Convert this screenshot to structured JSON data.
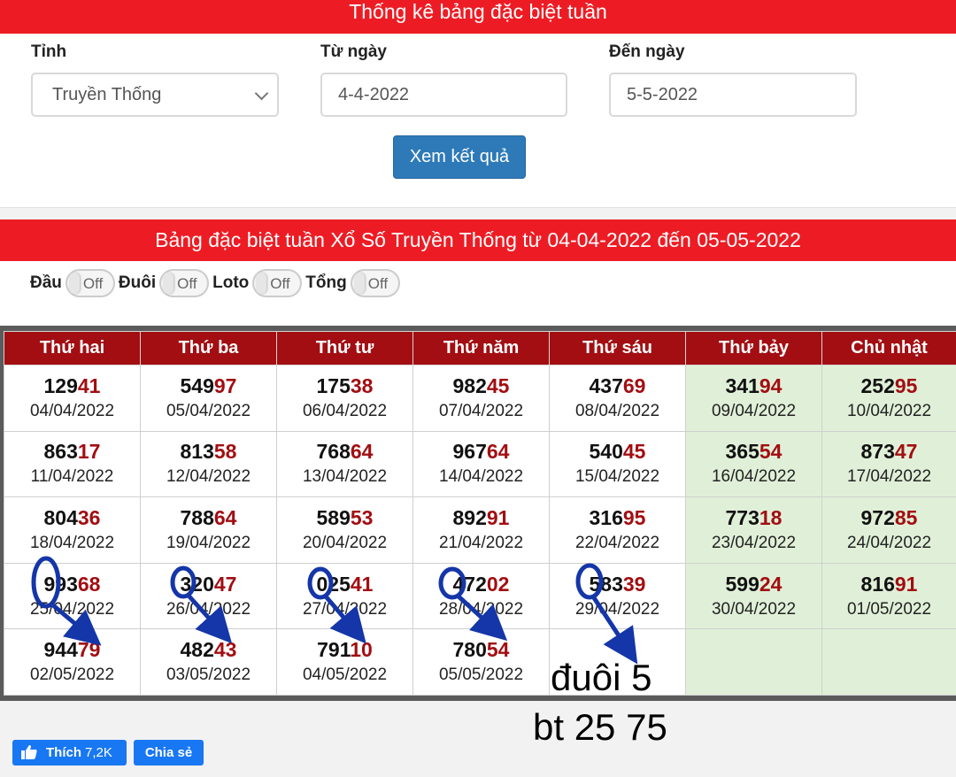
{
  "header": {
    "title": "Thống kê bảng đặc biệt tuần"
  },
  "form": {
    "province_label": "Tỉnh",
    "province_value": "Truyền Thống",
    "from_label": "Từ ngày",
    "from_value": "4-4-2022",
    "to_label": "Đến ngày",
    "to_value": "5-5-2022",
    "submit_label": "Xem kết quả"
  },
  "table_title": "Bảng đặc biệt tuần Xổ Số Truyền Thống từ 04-04-2022 đến 05-05-2022",
  "toggles": [
    {
      "label": "Đầu",
      "state": "Off"
    },
    {
      "label": "Đuôi",
      "state": "Off"
    },
    {
      "label": "Loto",
      "state": "Off"
    },
    {
      "label": "Tổng",
      "state": "Off"
    }
  ],
  "days": [
    "Thứ hai",
    "Thứ ba",
    "Thứ tư",
    "Thứ năm",
    "Thứ sáu",
    "Thứ bảy",
    "Chủ nhật"
  ],
  "rows": [
    [
      {
        "head": "129",
        "tail": "41",
        "date": "04/04/2022"
      },
      {
        "head": "549",
        "tail": "97",
        "date": "05/04/2022"
      },
      {
        "head": "175",
        "tail": "38",
        "date": "06/04/2022"
      },
      {
        "head": "982",
        "tail": "45",
        "date": "07/04/2022"
      },
      {
        "head": "437",
        "tail": "69",
        "date": "08/04/2022"
      },
      {
        "head": "341",
        "tail": "94",
        "date": "09/04/2022"
      },
      {
        "head": "252",
        "tail": "95",
        "date": "10/04/2022"
      }
    ],
    [
      {
        "head": "863",
        "tail": "17",
        "date": "11/04/2022"
      },
      {
        "head": "813",
        "tail": "58",
        "date": "12/04/2022"
      },
      {
        "head": "768",
        "tail": "64",
        "date": "13/04/2022"
      },
      {
        "head": "967",
        "tail": "64",
        "date": "14/04/2022"
      },
      {
        "head": "540",
        "tail": "45",
        "date": "15/04/2022"
      },
      {
        "head": "365",
        "tail": "54",
        "date": "16/04/2022"
      },
      {
        "head": "873",
        "tail": "47",
        "date": "17/04/2022"
      }
    ],
    [
      {
        "head": "804",
        "tail": "36",
        "date": "18/04/2022"
      },
      {
        "head": "788",
        "tail": "64",
        "date": "19/04/2022"
      },
      {
        "head": "589",
        "tail": "53",
        "date": "20/04/2022"
      },
      {
        "head": "892",
        "tail": "91",
        "date": "21/04/2022"
      },
      {
        "head": "316",
        "tail": "95",
        "date": "22/04/2022"
      },
      {
        "head": "773",
        "tail": "18",
        "date": "23/04/2022"
      },
      {
        "head": "972",
        "tail": "85",
        "date": "24/04/2022"
      }
    ],
    [
      {
        "head": "993",
        "tail": "68",
        "date": "25/04/2022"
      },
      {
        "head": "320",
        "tail": "47",
        "date": "26/04/2022"
      },
      {
        "head": "025",
        "tail": "41",
        "date": "27/04/2022"
      },
      {
        "head": "472",
        "tail": "02",
        "date": "28/04/2022"
      },
      {
        "head": "583",
        "tail": "39",
        "date": "29/04/2022"
      },
      {
        "head": "599",
        "tail": "24",
        "date": "30/04/2022"
      },
      {
        "head": "816",
        "tail": "91",
        "date": "01/05/2022"
      }
    ],
    [
      {
        "head": "944",
        "tail": "79",
        "date": "02/05/2022"
      },
      {
        "head": "482",
        "tail": "43",
        "date": "03/05/2022"
      },
      {
        "head": "791",
        "tail": "10",
        "date": "04/05/2022"
      },
      {
        "head": "780",
        "tail": "54",
        "date": "05/05/2022"
      },
      null,
      null,
      null
    ]
  ],
  "annotations": {
    "line1": "đuôi 5",
    "line2": "bt 25 75",
    "color": "#1536a8"
  },
  "social": {
    "like_label": "Thích",
    "like_count": "7,2K",
    "share_label": "Chia sẻ"
  },
  "colors": {
    "banner": "#ed1c24",
    "header_row": "#a20e12",
    "tail_digits": "#a20e12",
    "weekend_bg": "#e0f0d8",
    "button": "#2e7ab8",
    "facebook": "#1877f2"
  },
  "icons": [
    "chevron-down-icon",
    "thumbs-up-icon"
  ]
}
